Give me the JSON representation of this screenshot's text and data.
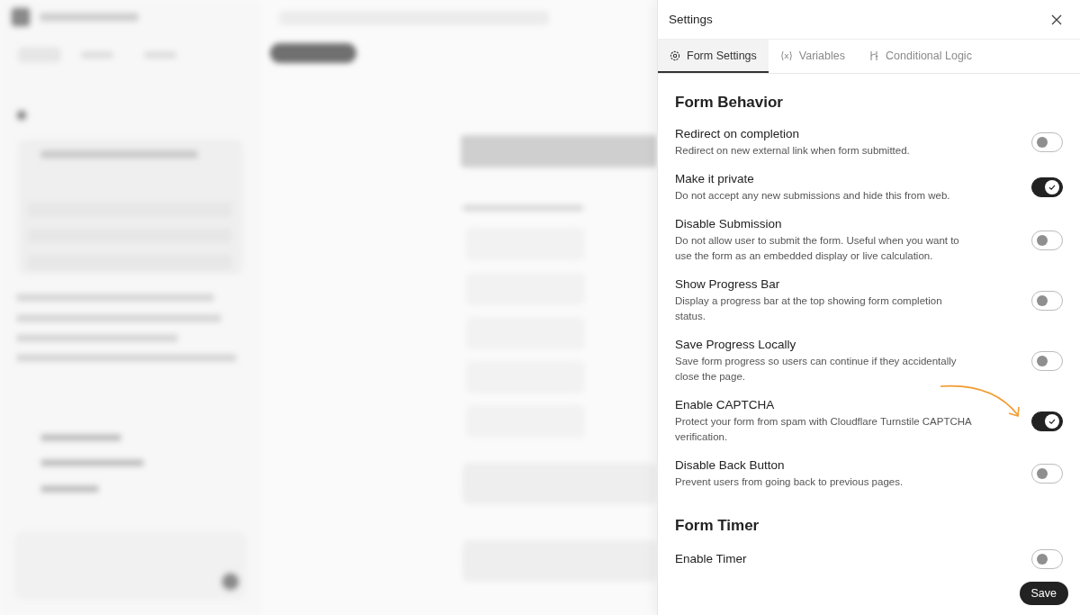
{
  "panel": {
    "title": "Settings"
  },
  "tabs": [
    {
      "label": "Form Settings",
      "selected": true
    },
    {
      "label": "Variables",
      "selected": false
    },
    {
      "label": "Conditional Logic",
      "selected": false
    }
  ],
  "sections": [
    {
      "title": "Form Behavior",
      "settings": [
        {
          "kind": "toggle",
          "label": "Redirect on completion",
          "description": "Redirect on new external link when form submitted.",
          "on": false,
          "highlighted": false
        },
        {
          "kind": "toggle",
          "label": "Make it private",
          "description": "Do not accept any new submissions and hide this from web.",
          "on": true,
          "highlighted": false
        },
        {
          "kind": "toggle",
          "label": "Disable Submission",
          "description": "Do not allow user to submit the form. Useful when you want to use the form as an embedded display or live calculation.",
          "on": false,
          "highlighted": false
        },
        {
          "kind": "toggle",
          "label": "Show Progress Bar",
          "description": "Display a progress bar at the top showing form completion status.",
          "on": false,
          "highlighted": false
        },
        {
          "kind": "toggle",
          "label": "Save Progress Locally",
          "description": "Save form progress so users can continue if they accidentally close the page.",
          "on": false,
          "highlighted": false
        },
        {
          "kind": "toggle",
          "label": "Enable CAPTCHA",
          "description": "Protect your form from spam with Cloudflare Turnstile CAPTCHA verification.",
          "on": true,
          "highlighted": true
        },
        {
          "kind": "toggle",
          "label": "Disable Back Button",
          "description": "Prevent users from going back to previous pages.",
          "on": false,
          "highlighted": false
        }
      ]
    },
    {
      "title": "Form Timer",
      "settings": [
        {
          "kind": "toggle",
          "label": "Enable Timer",
          "on": false,
          "highlighted": false
        }
      ]
    }
  ],
  "footer": {
    "save_button": "Save"
  }
}
